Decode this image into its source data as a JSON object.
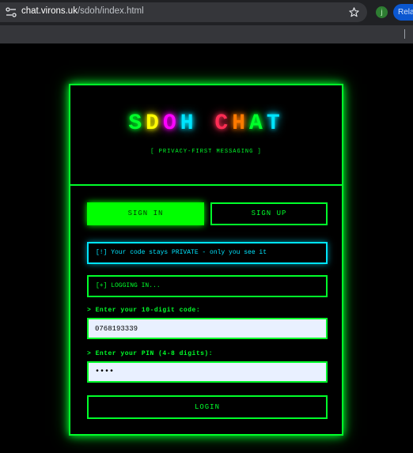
{
  "browser": {
    "url_host": "chat.virons.uk",
    "url_path": "/sdoh/index.html",
    "profile_initial": "j",
    "relaunch_label": "Rela"
  },
  "header": {
    "logo_letters": [
      {
        "char": "S",
        "color": "#00ff2a"
      },
      {
        "char": "D",
        "color": "#ffff00"
      },
      {
        "char": "O",
        "color": "#ff00ff"
      },
      {
        "char": "H",
        "color": "#00e5ff"
      },
      {
        "char": " ",
        "color": "#000000"
      },
      {
        "char": "C",
        "color": "#ff2d55"
      },
      {
        "char": "H",
        "color": "#ff7a00"
      },
      {
        "char": "A",
        "color": "#00ff2a"
      },
      {
        "char": "T",
        "color": "#00e5ff"
      }
    ],
    "tagline": "[ PRIVACY-FIRST MESSAGING ]"
  },
  "tabs": {
    "signin_label": "SIGN IN",
    "signup_label": "SIGN UP"
  },
  "notices": {
    "private": "[!] Your code stays PRIVATE - only you see it",
    "status": "[+] LOGGING IN..."
  },
  "form": {
    "code_label": "> Enter your 10-digit code:",
    "code_value": "0768193339",
    "pin_label": "> Enter your PIN (4-8 digits):",
    "pin_value": "1234",
    "login_label": "LOGIN"
  },
  "colors": {
    "accent": "#00ff2a",
    "info": "#00e5ff",
    "background": "#000000"
  }
}
